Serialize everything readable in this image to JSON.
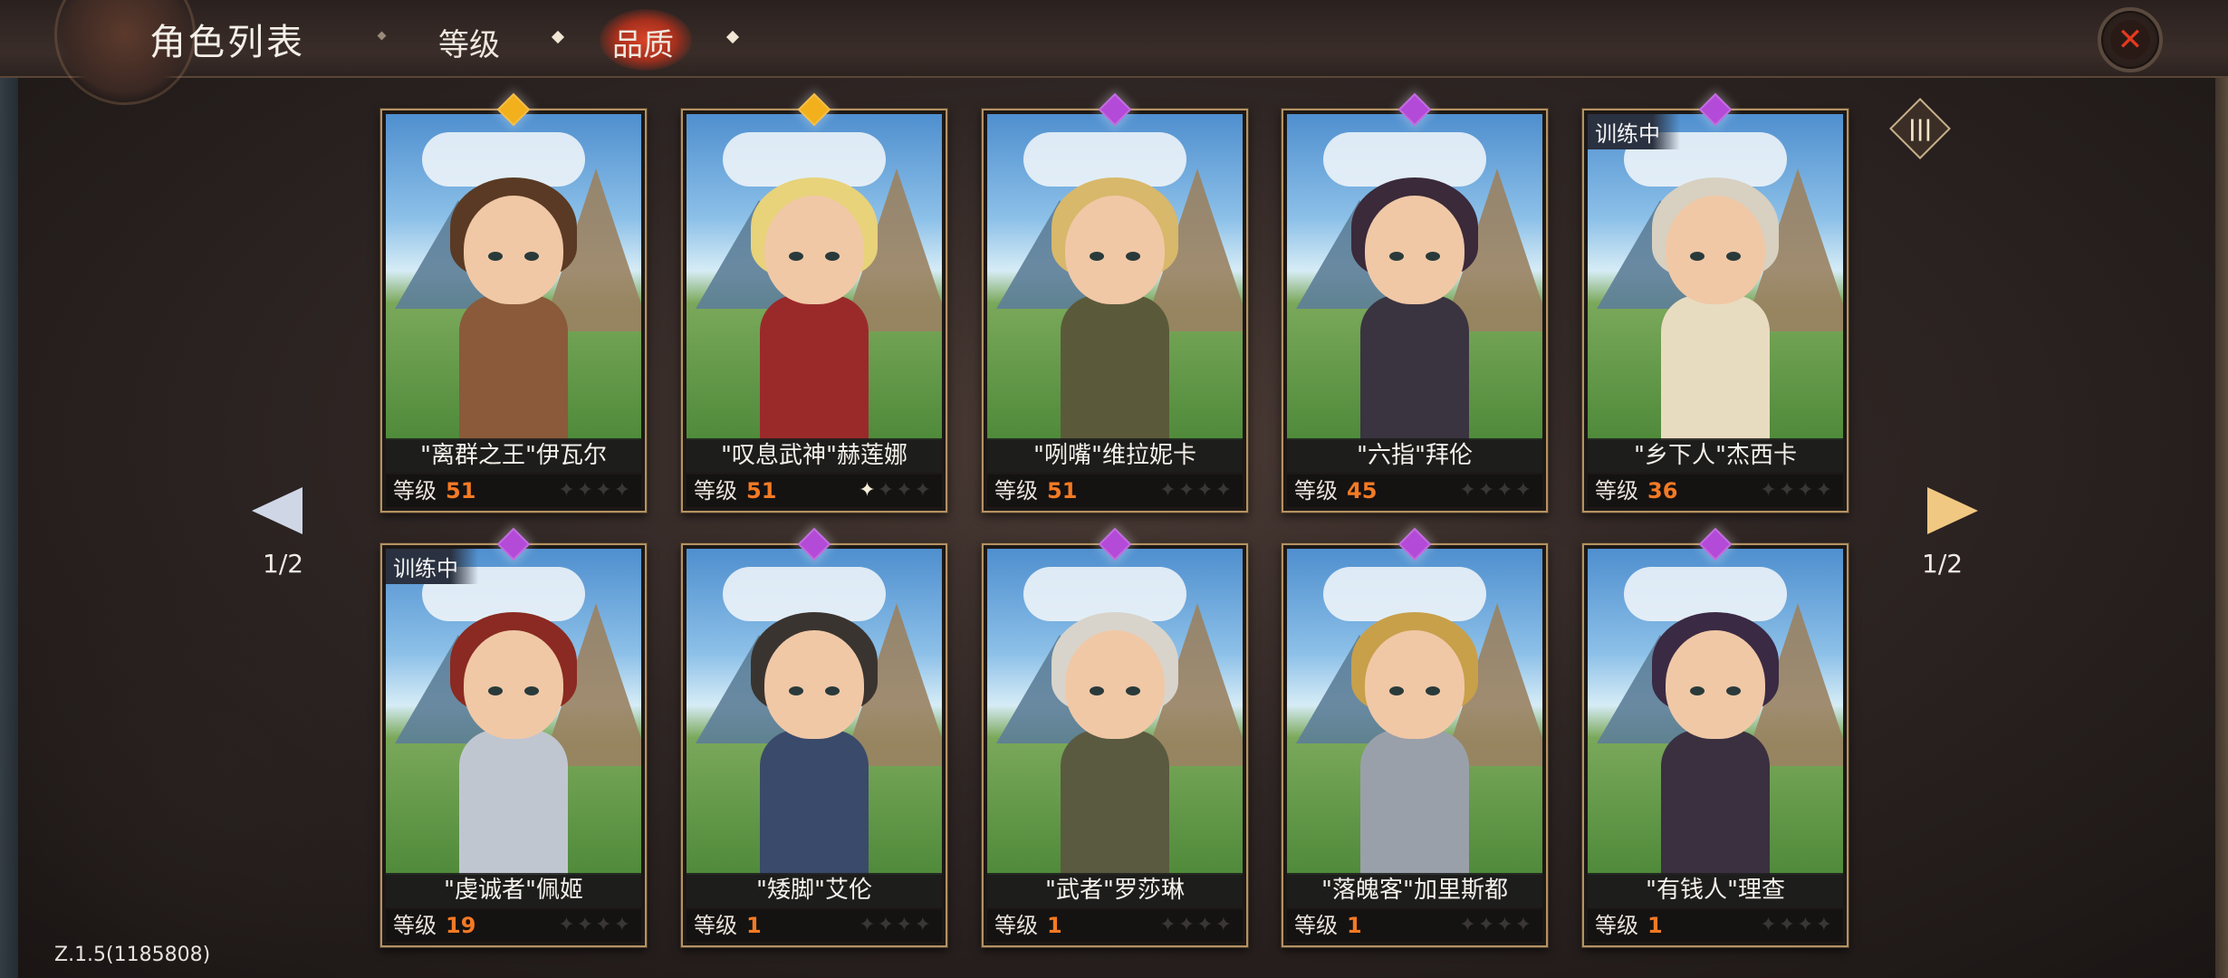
{
  "header": {
    "title": "角色列表",
    "tabs": [
      {
        "label": "等级",
        "active": false
      },
      {
        "label": "品质",
        "active": true
      }
    ],
    "close_icon": "close-x-icon"
  },
  "pagination": {
    "left_indicator": "1/2",
    "right_indicator": "1/2"
  },
  "filter_icon": "column-filter-icon",
  "level_label": "等级",
  "training_label": "训练中",
  "colors": {
    "gold": "#f2b01c",
    "purple": "#b44ad8",
    "level_orange": "#f47a24",
    "accent_red": "#d9442a"
  },
  "characters": [
    {
      "name": "\"离群之王\"伊瓦尔",
      "level": "51",
      "quality": "gold",
      "stars_on": 0,
      "training": false
    },
    {
      "name": "\"叹息武神\"赫莲娜",
      "level": "51",
      "quality": "gold",
      "stars_on": 1,
      "training": false
    },
    {
      "name": "\"咧嘴\"维拉妮卡",
      "level": "51",
      "quality": "purple",
      "stars_on": 0,
      "training": false
    },
    {
      "name": "\"六指\"拜伦",
      "level": "45",
      "quality": "purple",
      "stars_on": 0,
      "training": false
    },
    {
      "name": "\"乡下人\"杰西卡",
      "level": "36",
      "quality": "purple",
      "stars_on": 0,
      "training": true
    },
    {
      "name": "\"虔诚者\"佩姬",
      "level": "19",
      "quality": "purple",
      "stars_on": 0,
      "training": true
    },
    {
      "name": "\"矮脚\"艾伦",
      "level": "1",
      "quality": "purple",
      "stars_on": 0,
      "training": false
    },
    {
      "name": "\"武者\"罗莎琳",
      "level": "1",
      "quality": "purple",
      "stars_on": 0,
      "training": false
    },
    {
      "name": "\"落魄客\"加里斯都",
      "level": "1",
      "quality": "purple",
      "stars_on": 0,
      "training": false
    },
    {
      "name": "\"有钱人\"理查",
      "level": "1",
      "quality": "purple",
      "stars_on": 0,
      "training": false
    }
  ],
  "version": "Z.1.5(1185808)"
}
